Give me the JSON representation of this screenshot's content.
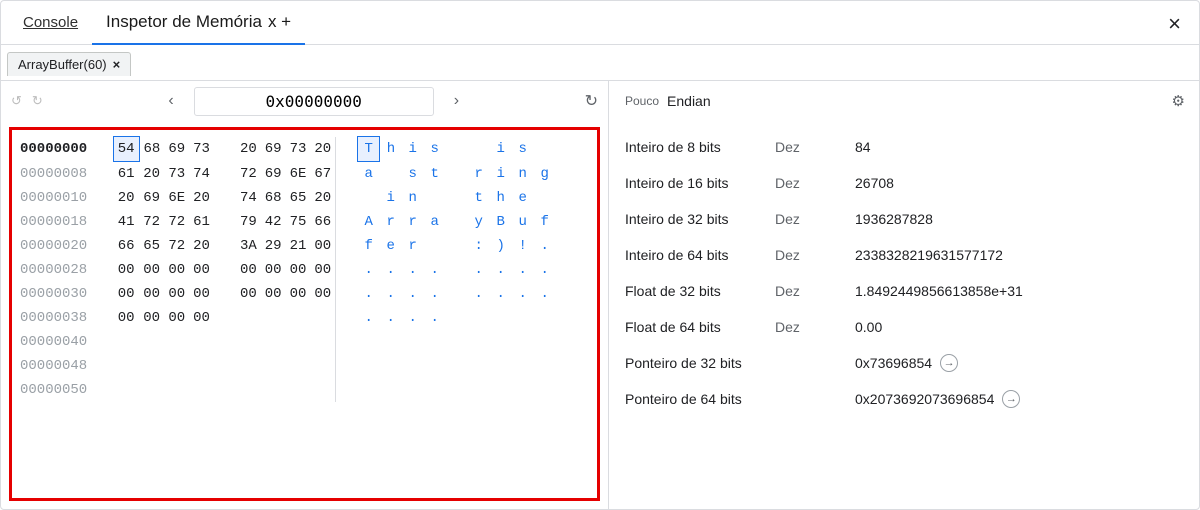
{
  "tabs": {
    "console": "Console",
    "memory_inspector": "Inspetor de Memória",
    "memory_inspector_suffix": "x +"
  },
  "sub_tab": {
    "label": "ArrayBuffer(60)",
    "close": "×"
  },
  "close_button": "×",
  "address_input": "0x00000000",
  "nav": {
    "prev": "‹",
    "next": "›",
    "refresh": "↻",
    "undo": "↺",
    "redo": "↻"
  },
  "hex_rows": [
    {
      "addr": "00000000",
      "hex": [
        "54",
        "68",
        "69",
        "73",
        "20",
        "69",
        "73",
        "20"
      ],
      "asc": [
        "T",
        "h",
        "i",
        "s",
        " ",
        "i",
        "s",
        " "
      ],
      "selected": true
    },
    {
      "addr": "00000008",
      "hex": [
        "61",
        "20",
        "73",
        "74",
        "72",
        "69",
        "6E",
        "67"
      ],
      "asc": [
        "a",
        " ",
        "s",
        "t",
        "r",
        "i",
        "n",
        "g"
      ]
    },
    {
      "addr": "00000010",
      "hex": [
        "20",
        "69",
        "6E",
        "20",
        "74",
        "68",
        "65",
        "20"
      ],
      "asc": [
        " ",
        "i",
        "n",
        " ",
        "t",
        "h",
        "e",
        " "
      ]
    },
    {
      "addr": "00000018",
      "hex": [
        "41",
        "72",
        "72",
        "61",
        "79",
        "42",
        "75",
        "66"
      ],
      "asc": [
        "A",
        "r",
        "r",
        "a",
        "y",
        "B",
        "u",
        "f"
      ]
    },
    {
      "addr": "00000020",
      "hex": [
        "66",
        "65",
        "72",
        "20",
        "3A",
        "29",
        "21",
        "00"
      ],
      "asc": [
        "f",
        "e",
        "r",
        " ",
        ":",
        ")",
        "!",
        "."
      ]
    },
    {
      "addr": "00000028",
      "hex": [
        "00",
        "00",
        "00",
        "00",
        "00",
        "00",
        "00",
        "00"
      ],
      "asc": [
        ".",
        ".",
        ".",
        ".",
        ".",
        ".",
        ".",
        "."
      ]
    },
    {
      "addr": "00000030",
      "hex": [
        "00",
        "00",
        "00",
        "00",
        "00",
        "00",
        "00",
        "00"
      ],
      "asc": [
        ".",
        ".",
        ".",
        ".",
        ".",
        ".",
        ".",
        "."
      ]
    },
    {
      "addr": "00000038",
      "hex": [
        "00",
        "00",
        "00",
        "00"
      ],
      "asc": [
        ".",
        ".",
        ".",
        "."
      ]
    },
    {
      "addr": "00000040",
      "hex": [],
      "asc": []
    },
    {
      "addr": "00000048",
      "hex": [],
      "asc": []
    },
    {
      "addr": "00000050",
      "hex": [],
      "asc": []
    }
  ],
  "endian": {
    "label": "Pouco",
    "value": "Endian"
  },
  "interp": [
    {
      "label": "Inteiro de 8 bits",
      "mode": "Dez",
      "value": "84"
    },
    {
      "label": "Inteiro de 16 bits",
      "mode": "Dez",
      "value": "26708"
    },
    {
      "label": "Inteiro de 32 bits",
      "mode": "Dez",
      "value": "1936287828"
    },
    {
      "label": "Inteiro de 64 bits",
      "mode": "Dez",
      "value": "2338328219631577172"
    },
    {
      "label": "Float de 32 bits",
      "mode": "Dez",
      "value": "1.8492449856613858e+31"
    },
    {
      "label": "Float de 64 bits",
      "mode": "Dez",
      "value": "0.00"
    },
    {
      "label": "Ponteiro de 32 bits",
      "mode": "",
      "value": "0x73696854",
      "go": true
    },
    {
      "label": "Ponteiro de 64 bits",
      "mode": "",
      "value": "0x2073692073696854",
      "go": true
    }
  ],
  "icons": {
    "gear": "⚙",
    "go": "→"
  }
}
